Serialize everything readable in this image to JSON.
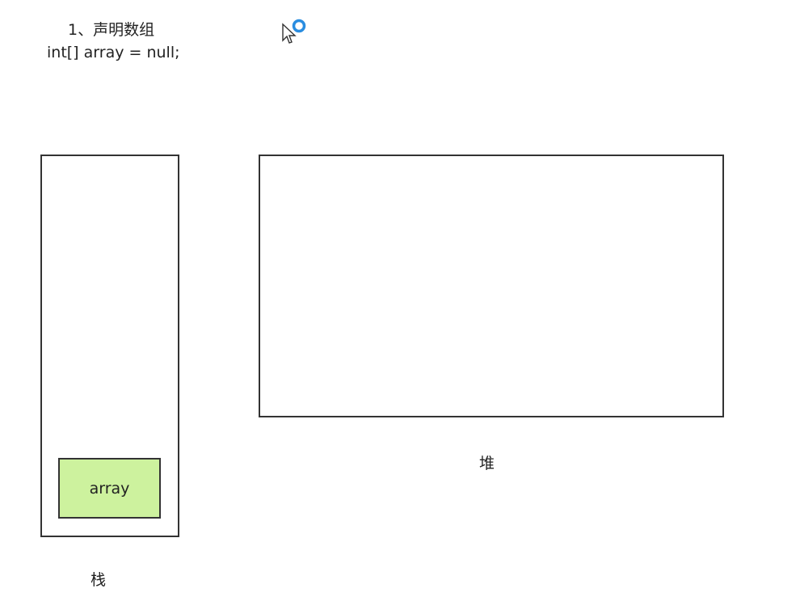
{
  "title": {
    "step": "1、声明数组",
    "code": "int[] array = null;"
  },
  "stack": {
    "label": "栈",
    "variable": "array",
    "variable_color": "#cdf29e"
  },
  "heap": {
    "label": "堆"
  }
}
